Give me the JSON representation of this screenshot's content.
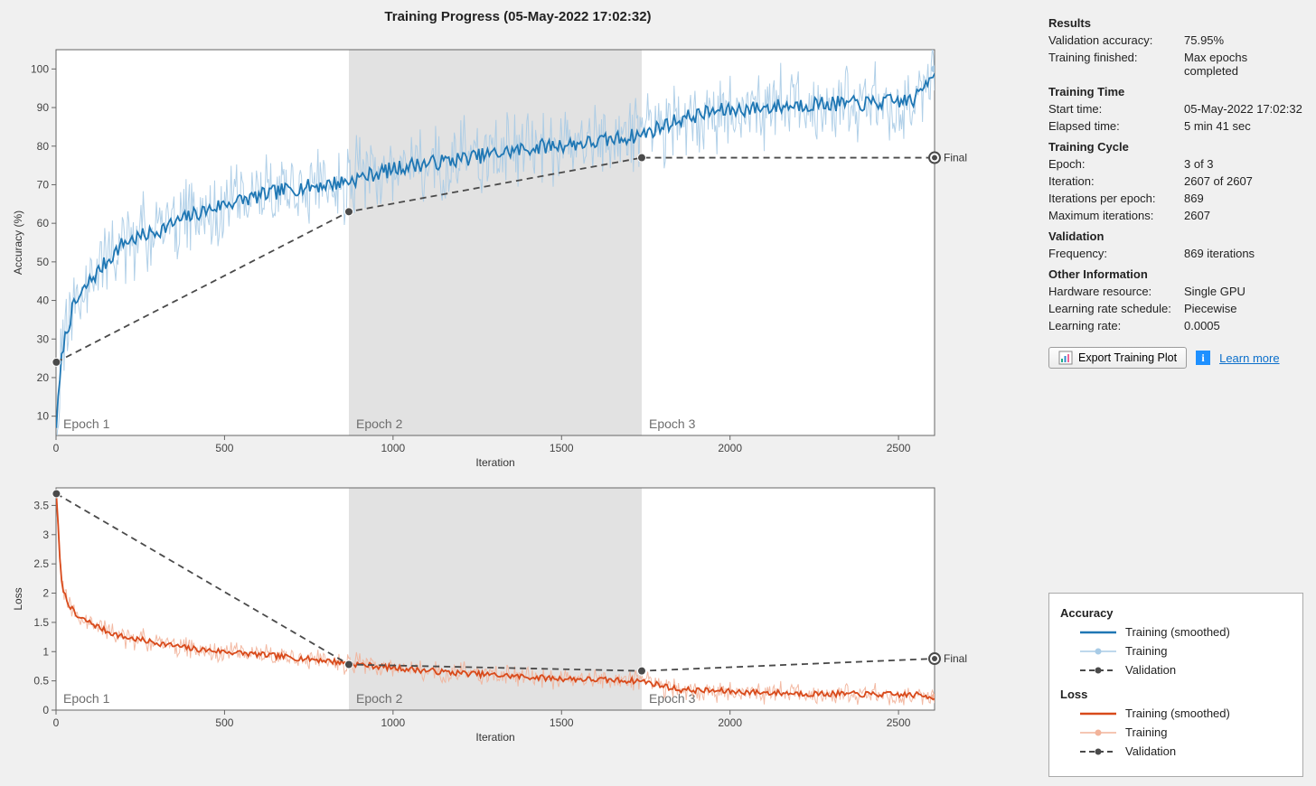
{
  "title": "Training Progress (05-May-2022 17:02:32)",
  "results": {
    "heading": "Results",
    "validation_accuracy_label": "Validation accuracy:",
    "validation_accuracy": "75.95%",
    "training_finished_label": "Training finished:",
    "training_finished": "Max epochs completed"
  },
  "training_time": {
    "heading": "Training Time",
    "start_label": "Start time:",
    "start": "05-May-2022 17:02:32",
    "elapsed_label": "Elapsed time:",
    "elapsed": "5 min 41 sec"
  },
  "training_cycle": {
    "heading": "Training Cycle",
    "epoch_label": "Epoch:",
    "epoch": "3 of 3",
    "iteration_label": "Iteration:",
    "iteration": "2607 of 2607",
    "ipe_label": "Iterations per epoch:",
    "ipe": "869",
    "maxiter_label": "Maximum iterations:",
    "maxiter": "2607"
  },
  "validation": {
    "heading": "Validation",
    "freq_label": "Frequency:",
    "freq": "869 iterations"
  },
  "other": {
    "heading": "Other Information",
    "hw_label": "Hardware resource:",
    "hw": "Single GPU",
    "lrs_label": "Learning rate schedule:",
    "lrs": "Piecewise",
    "lr_label": "Learning rate:",
    "lr": "0.0005"
  },
  "buttons": {
    "export": "Export Training Plot",
    "learn_more": "Learn more"
  },
  "legend": {
    "accuracy_heading": "Accuracy",
    "loss_heading": "Loss",
    "training_smoothed": "Training (smoothed)",
    "training": "Training",
    "validation": "Validation"
  },
  "chart_labels": {
    "accuracy_y": "Accuracy (%)",
    "loss_y": "Loss",
    "x": "Iteration",
    "epoch1": "Epoch 1",
    "epoch2": "Epoch 2",
    "epoch3": "Epoch 3",
    "final": "Final"
  },
  "chart_data": [
    {
      "type": "line",
      "title": "Accuracy",
      "xlabel": "Iteration",
      "ylabel": "Accuracy (%)",
      "xlim": [
        0,
        2607
      ],
      "ylim": [
        5,
        105
      ],
      "yticks": [
        10,
        20,
        30,
        40,
        50,
        60,
        70,
        80,
        90,
        100
      ],
      "xticks": [
        0,
        500,
        1000,
        1500,
        2000,
        2500
      ],
      "epoch_boundaries": [
        0,
        869,
        1738,
        2607
      ],
      "series": [
        {
          "name": "Training (smoothed)",
          "color": "#1f77b4",
          "x": [
            1,
            20,
            50,
            100,
            150,
            200,
            300,
            400,
            500,
            600,
            700,
            800,
            869,
            950,
            1050,
            1150,
            1300,
            1450,
            1600,
            1738,
            1850,
            1950,
            2100,
            2250,
            2400,
            2550,
            2607
          ],
          "values": [
            8,
            28,
            38,
            45,
            50,
            55,
            58,
            62,
            65,
            67,
            69,
            70,
            71,
            73,
            75,
            76,
            78,
            80,
            81,
            83,
            87,
            89,
            90,
            91,
            91,
            92,
            100
          ]
        },
        {
          "name": "Training",
          "color": "#a8cbe6",
          "note": "Raw noisy mini-batch accuracy (rendered as band around smoothed)",
          "x": [
            1,
            20,
            50,
            100,
            150,
            200,
            300,
            400,
            500,
            600,
            700,
            800,
            869,
            950,
            1050,
            1150,
            1300,
            1450,
            1600,
            1738,
            1850,
            1950,
            2100,
            2250,
            2400,
            2550,
            2607
          ],
          "values": [
            8,
            28,
            38,
            45,
            50,
            55,
            58,
            62,
            65,
            67,
            69,
            70,
            71,
            73,
            75,
            76,
            78,
            80,
            81,
            83,
            87,
            89,
            90,
            91,
            91,
            92,
            100
          ],
          "noise_amplitude": 10
        },
        {
          "name": "Validation",
          "color": "#4a4a4a",
          "dashed": true,
          "x": [
            1,
            869,
            1738,
            2607
          ],
          "values": [
            24,
            63,
            77,
            77
          ]
        }
      ]
    },
    {
      "type": "line",
      "title": "Loss",
      "xlabel": "Iteration",
      "ylabel": "Loss",
      "xlim": [
        0,
        2607
      ],
      "ylim": [
        0,
        3.8
      ],
      "yticks": [
        0,
        0.5,
        1,
        1.5,
        2,
        2.5,
        3,
        3.5
      ],
      "xticks": [
        0,
        500,
        1000,
        1500,
        2000,
        2500
      ],
      "epoch_boundaries": [
        0,
        869,
        1738,
        2607
      ],
      "series": [
        {
          "name": "Training (smoothed)",
          "color": "#d84a1b",
          "x": [
            1,
            15,
            30,
            60,
            100,
            150,
            200,
            300,
            400,
            500,
            600,
            700,
            800,
            869,
            950,
            1050,
            1150,
            1300,
            1450,
            1600,
            1738,
            1850,
            1950,
            2100,
            2250,
            2400,
            2550,
            2607
          ],
          "values": [
            3.7,
            2.2,
            1.9,
            1.6,
            1.5,
            1.35,
            1.25,
            1.15,
            1.05,
            1.0,
            0.95,
            0.9,
            0.85,
            0.8,
            0.75,
            0.7,
            0.65,
            0.6,
            0.55,
            0.52,
            0.5,
            0.35,
            0.33,
            0.3,
            0.28,
            0.27,
            0.26,
            0.22
          ]
        },
        {
          "name": "Training",
          "color": "#f2b39a",
          "note": "Raw noisy mini-batch loss (rendered as band around smoothed)",
          "x": [
            1,
            15,
            30,
            60,
            100,
            150,
            200,
            300,
            400,
            500,
            600,
            700,
            800,
            869,
            950,
            1050,
            1150,
            1300,
            1450,
            1600,
            1738,
            1850,
            1950,
            2100,
            2250,
            2400,
            2550,
            2607
          ],
          "values": [
            3.7,
            2.2,
            1.9,
            1.6,
            1.5,
            1.35,
            1.25,
            1.15,
            1.05,
            1.0,
            0.95,
            0.9,
            0.85,
            0.8,
            0.75,
            0.7,
            0.65,
            0.6,
            0.55,
            0.52,
            0.5,
            0.35,
            0.33,
            0.3,
            0.28,
            0.27,
            0.26,
            0.22
          ],
          "noise_amplitude": 0.18
        },
        {
          "name": "Validation",
          "color": "#4a4a4a",
          "dashed": true,
          "x": [
            1,
            869,
            1738,
            2607
          ],
          "values": [
            3.7,
            0.78,
            0.67,
            0.88
          ]
        }
      ]
    }
  ]
}
